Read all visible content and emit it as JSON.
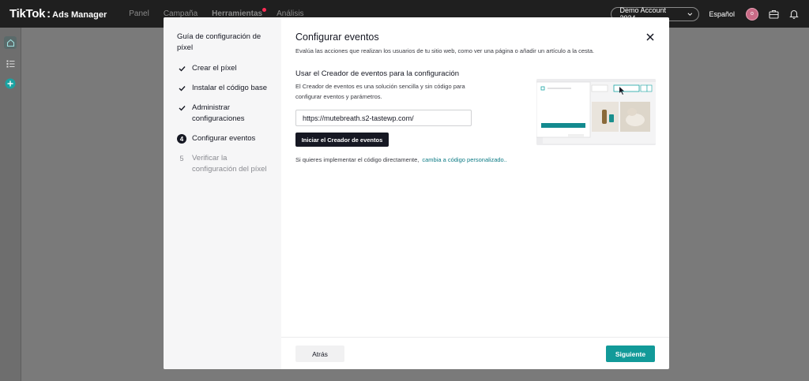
{
  "app": {
    "logo_brand": "TikTok",
    "logo_separator": ":",
    "logo_product": "Ads Manager"
  },
  "nav": {
    "items": [
      {
        "label": "Panel",
        "active": false
      },
      {
        "label": "Campaña",
        "active": false
      },
      {
        "label": "Herramientas",
        "active": true
      },
      {
        "label": "Análisis",
        "active": false
      }
    ]
  },
  "header": {
    "account": "Demo Account 2024",
    "language": "Español",
    "avatar_initial": "o"
  },
  "sidebar_icons": [
    "home-icon",
    "list-icon",
    "add-icon"
  ],
  "modal": {
    "guide_title": "Guía de configuración de píxel",
    "steps": [
      {
        "marker": "✓",
        "label": "Crear el píxel",
        "status": "done"
      },
      {
        "marker": "✓",
        "label": "Instalar el código base",
        "status": "done"
      },
      {
        "marker": "✓",
        "label": "Administrar configuraciones",
        "status": "done"
      },
      {
        "marker": "4",
        "label": "Configurar eventos",
        "status": "current"
      },
      {
        "marker": "5",
        "label": "Verificar la configuración del píxel",
        "status": "pending"
      }
    ],
    "title": "Configurar eventos",
    "subtitle": "Evalúa las acciones que realizan los usuarios de tu sitio web, como ver una página o añadir un artículo a la cesta.",
    "section_title": "Usar el Creador de eventos para la configuración",
    "section_desc": "El Creador de eventos es una solución sencilla y sin código para configurar eventos y parámetros.",
    "url_value": "https://mutebreath.s2-tastewp.com/",
    "launch_button": "Iniciar el Creador de eventos",
    "hint_text": "Si quieres implementar el código directamente,",
    "hint_link": "cambia a código personalizado..",
    "back_button": "Atrás",
    "next_button": "Siguiente"
  },
  "colors": {
    "accent": "#129a99",
    "link": "#0e7c86",
    "topbar": "#1f1f1f",
    "notification_dot": "#fe2c55"
  }
}
